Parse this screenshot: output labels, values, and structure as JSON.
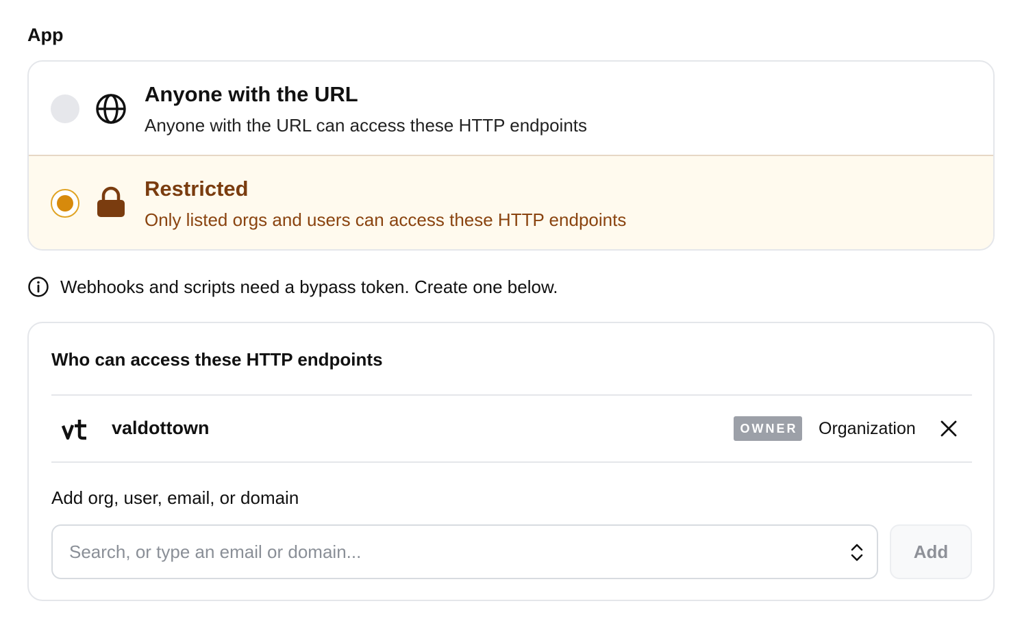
{
  "section": {
    "title": "App"
  },
  "options": [
    {
      "title": "Anyone with the URL",
      "description": "Anyone with the URL can access these HTTP endpoints",
      "icon": "globe-icon",
      "selected": false
    },
    {
      "title": "Restricted",
      "description": "Only listed orgs and users can access these HTTP endpoints",
      "icon": "lock-icon",
      "selected": true
    }
  ],
  "info": {
    "text": "Webhooks and scripts need a bypass token. Create one below.",
    "icon": "info-icon"
  },
  "access": {
    "title": "Who can access these HTTP endpoints",
    "members": [
      {
        "name": "valdottown",
        "badge": "OWNER",
        "type": "Organization",
        "logo": "val-town-logo-icon"
      }
    ],
    "add_label": "Add org, user, email, or domain",
    "search_placeholder": "Search, or type an email or domain...",
    "add_button": "Add"
  },
  "colors": {
    "accent": "#d78a0c",
    "selected_bg": "#fffaee",
    "selected_text": "#7a3c0f",
    "badge_bg": "#9ca0a8"
  }
}
